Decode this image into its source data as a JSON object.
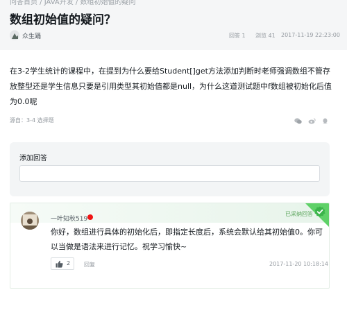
{
  "header": {
    "breadcrumb": "问答首页 / JAVA开发 / 数组初始值的疑问",
    "title": "数组初始值的疑问？",
    "author": "众生踊",
    "answers_label": "回答 1",
    "views_label": "浏览 41",
    "datetime": "2017-11-19 22:23:00"
  },
  "question": {
    "body": "在3-2学生统计的课程中，在提到为什么要给Student[]get方法添加判断时老师强调数组不管存放整型还是学生信息只要是引用类型其初始值都是null，为什么这道测试题中f数组被初始化后值为0.0呢",
    "source": "源自：3-4 选择题"
  },
  "share": {
    "icons": [
      "wechat-icon",
      "weibo-icon",
      "qq-icon"
    ]
  },
  "add_answer": {
    "label": "添加回答",
    "placeholder": ""
  },
  "reply": {
    "user": "一叶知秋519",
    "adopted": "已采纳回答",
    "text": "你好，数组进行具体的初始化后，即指定长度后，系统会默认给其初始值0。你可以当做是语法来进行记忆。祝学习愉快~",
    "likes": "2",
    "reply_label": "回复",
    "time": "2017-11-20 10:18:14"
  },
  "colors": {
    "accent_green": "#5fd168",
    "level_red": "#f01414"
  }
}
